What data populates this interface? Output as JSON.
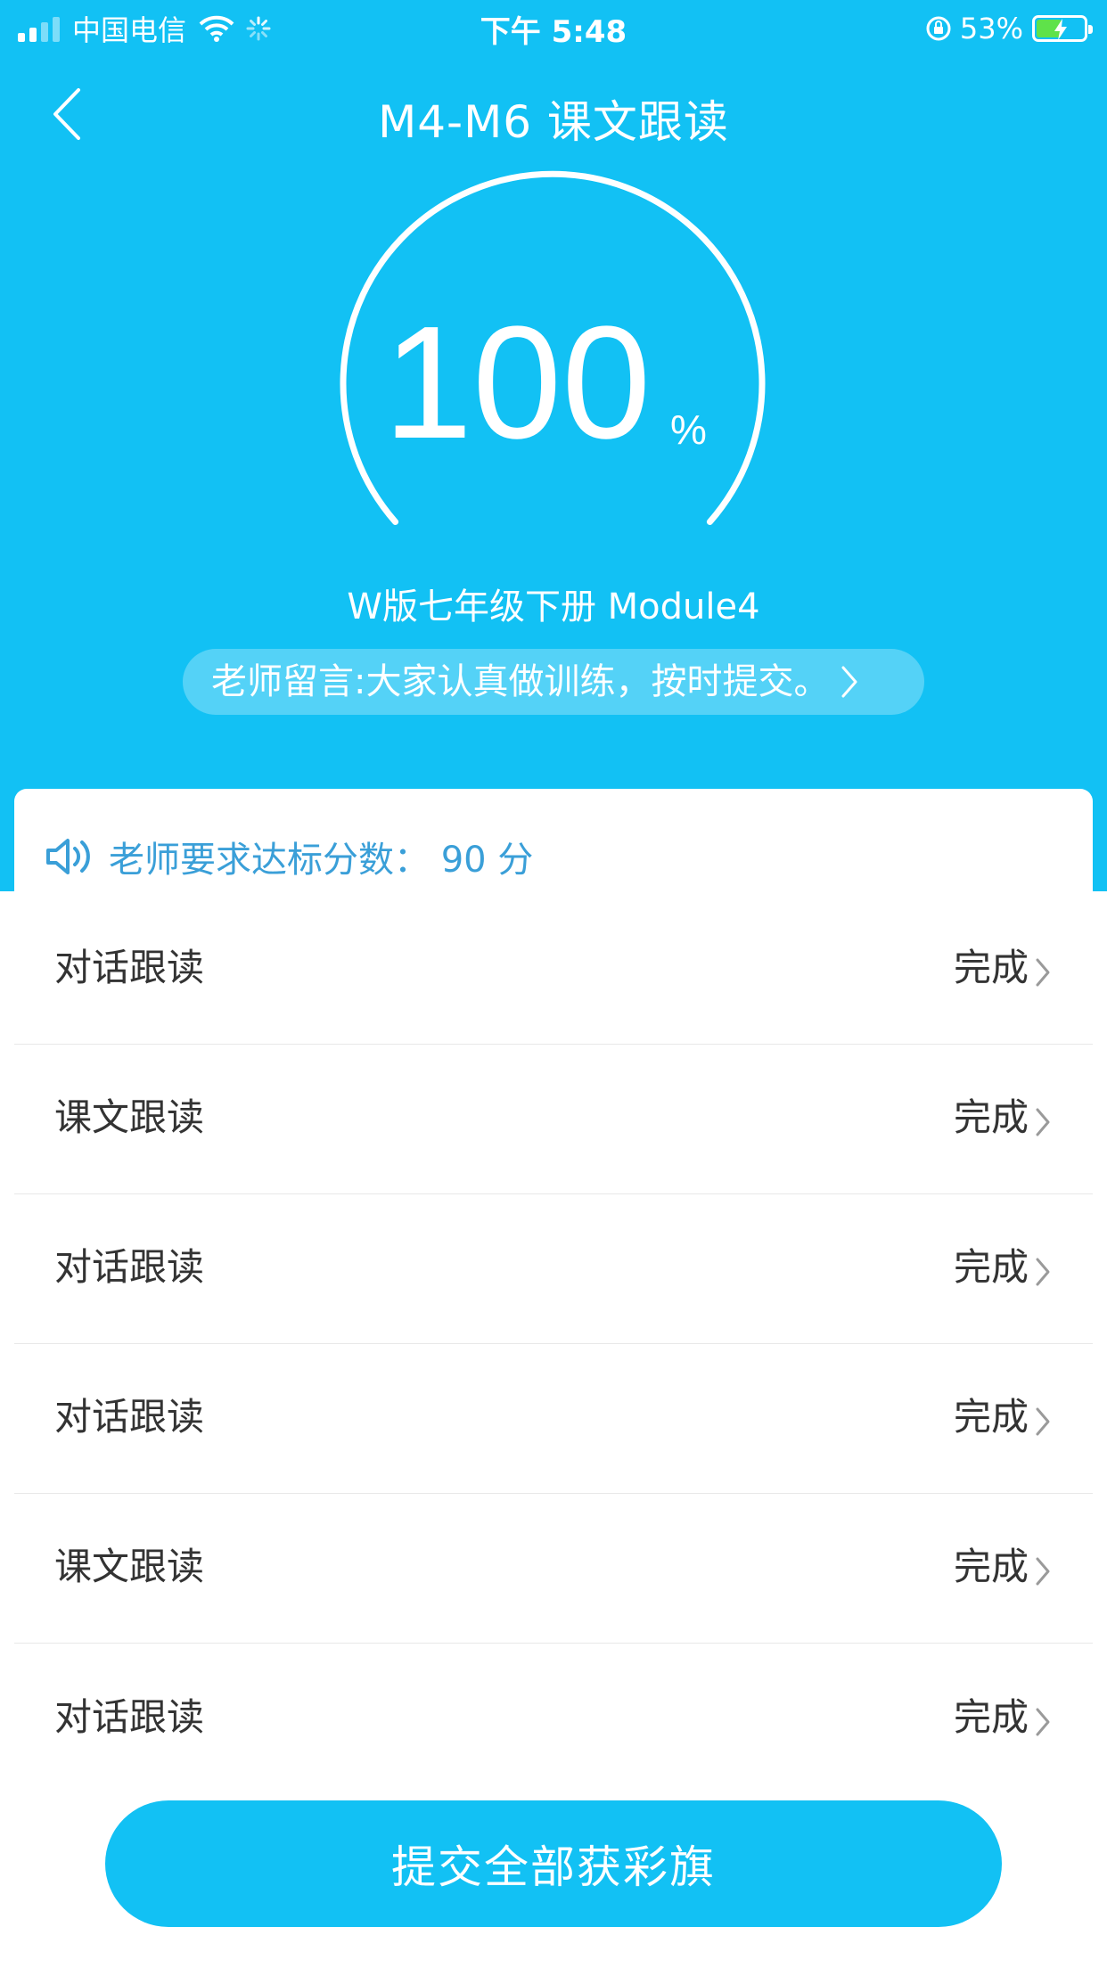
{
  "status_bar": {
    "carrier": "中国电信",
    "time": "下午 5:48",
    "battery": "53%"
  },
  "nav": {
    "title": "M4-M6 课文跟读"
  },
  "progress": {
    "value": "100",
    "unit": "%"
  },
  "book_name": "W版七年级下册 Module4",
  "teacher_note": "老师留言:大家认真做训练，按时提交。",
  "requirement": "老师要求达标分数：  90 分",
  "tasks": [
    {
      "name": "对话跟读",
      "status": "完成"
    },
    {
      "name": "课文跟读",
      "status": "完成"
    },
    {
      "name": "对话跟读",
      "status": "完成"
    },
    {
      "name": "对话跟读",
      "status": "完成"
    },
    {
      "name": "课文跟读",
      "status": "完成"
    },
    {
      "name": "对话跟读",
      "status": "完成"
    }
  ],
  "submit_label": "提交全部获彩旗",
  "colors": {
    "primary": "#12c1f4",
    "requirement_text": "#3a9fd8"
  }
}
